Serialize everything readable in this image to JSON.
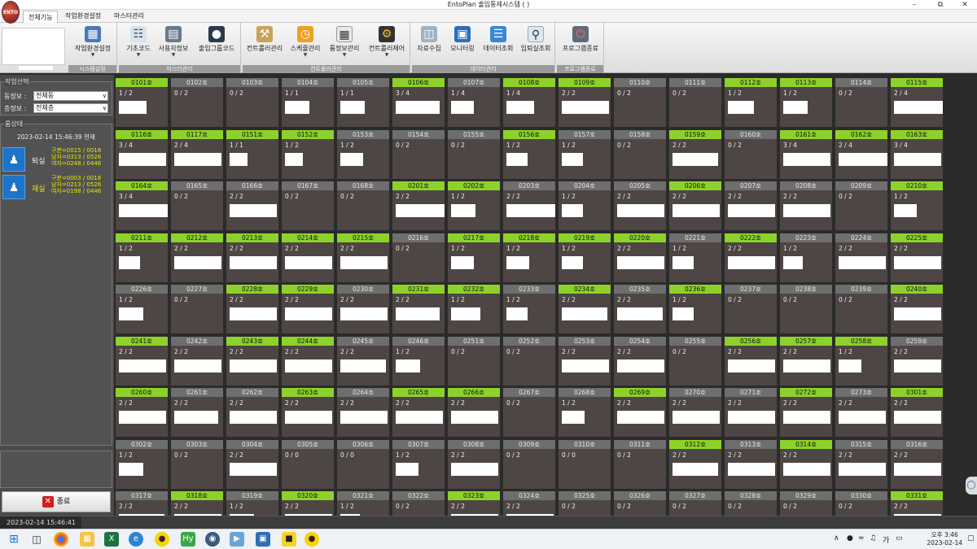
{
  "titlebar": {
    "title": "EntoPlan 출입통제시스템 (                              )",
    "logo": "ENTO",
    "minimize_icon": "minimize-icon",
    "maximize_icon": "maximize-icon",
    "close_icon": "close-icon"
  },
  "menu": {
    "tabs": [
      {
        "label": "전체기능"
      },
      {
        "label": "작업환경설정"
      },
      {
        "label": "마스터관리"
      }
    ]
  },
  "ribbon": {
    "groups": [
      {
        "label": "시스템설정",
        "buttons": [
          {
            "label": "작업환경설정",
            "icon": "work-settings-icon"
          }
        ]
      },
      {
        "label": "마스터관리",
        "buttons": [
          {
            "label": "기초코드",
            "icon": "base-code-icon"
          },
          {
            "label": "사용자정보",
            "icon": "user-info-icon"
          },
          {
            "label": "출입그룹코드",
            "icon": "access-group-icon"
          }
        ]
      },
      {
        "label": "컨트롤러관리",
        "buttons": [
          {
            "label": "컨트롤러관리",
            "icon": "controller-icon"
          },
          {
            "label": "스케쥴관리",
            "icon": "schedule-icon"
          },
          {
            "label": "룸정보관리",
            "icon": "room-info-icon"
          },
          {
            "label": "컨트롤러제어",
            "icon": "controller-control-icon"
          }
        ]
      },
      {
        "label": "데이터관리",
        "buttons": [
          {
            "label": "자료수집",
            "icon": "data-collect-icon"
          },
          {
            "label": "모니터링",
            "icon": "monitor-icon"
          },
          {
            "label": "데이터조회",
            "icon": "data-query-icon"
          },
          {
            "label": "입퇴실조회",
            "icon": "checkin-query-icon"
          }
        ]
      },
      {
        "label": "프로그램종료",
        "buttons": [
          {
            "label": "프로그램종료",
            "icon": "program-exit-icon"
          }
        ]
      }
    ]
  },
  "sidebar": {
    "task_title": "작업선택",
    "building_label": "동정보 :",
    "building_value": "전체동",
    "floor_label": "층정보 :",
    "floor_value": "전체층",
    "status_title": "룸상태",
    "timestamp": "2023-02-14 15:46:39 현재",
    "checkout_label": "퇴실",
    "checkout_stats": "구분=0015 / 0018\n남자=0313 / 0526\n여자=0248 / 0446",
    "occupied_label": "재실",
    "occupied_stats": "구분=0003 / 0018\n남자=0213 / 0526\n여자=0198 / 0446",
    "exit_label": "종료"
  },
  "rooms": [
    {
      "no": "0101호",
      "c": "1/2",
      "on": true,
      "w": 34
    },
    {
      "no": "0102호",
      "c": "0/2",
      "on": false,
      "w": 0
    },
    {
      "no": "0103호",
      "c": "0/2",
      "on": false,
      "w": 0
    },
    {
      "no": "0104호",
      "c": "1/1",
      "on": false,
      "w": 30
    },
    {
      "no": "0105호",
      "c": "1/1",
      "on": false,
      "w": 30
    },
    {
      "no": "0106호",
      "c": "3/4",
      "on": true,
      "w": 54
    },
    {
      "no": "0107호",
      "c": "1/4",
      "on": false,
      "w": 28
    },
    {
      "no": "0108호",
      "c": "1/4",
      "on": true,
      "w": 34
    },
    {
      "no": "0109호",
      "c": "2/2",
      "on": true,
      "w": 58
    },
    {
      "no": "0110호",
      "c": "0/2",
      "on": false,
      "w": 0
    },
    {
      "no": "0111호",
      "c": "0/2",
      "on": false,
      "w": 0
    },
    {
      "no": "0112호",
      "c": "1/2",
      "on": true,
      "w": 32
    },
    {
      "no": "0113호",
      "c": "1/2",
      "on": true,
      "w": 30
    },
    {
      "no": "0114호",
      "c": "0/2",
      "on": false,
      "w": 0
    },
    {
      "no": "0115호",
      "c": "2/4",
      "on": true,
      "w": 60
    },
    {
      "no": "0116호",
      "c": "3/4",
      "on": true,
      "w": 58
    },
    {
      "no": "0117호",
      "c": "2/4",
      "on": true,
      "w": 58
    },
    {
      "no": "0151호",
      "c": "1/1",
      "on": true,
      "w": 22
    },
    {
      "no": "0152호",
      "c": "1/2",
      "on": true,
      "w": 22
    },
    {
      "no": "0153호",
      "c": "1/2",
      "on": false,
      "w": 28
    },
    {
      "no": "0154호",
      "c": "0/2",
      "on": false,
      "w": 0
    },
    {
      "no": "0155호",
      "c": "0/2",
      "on": false,
      "w": 0
    },
    {
      "no": "0156호",
      "c": "1/2",
      "on": true,
      "w": 26
    },
    {
      "no": "0157호",
      "c": "1/2",
      "on": false,
      "w": 26
    },
    {
      "no": "0158호",
      "c": "0/2",
      "on": false,
      "w": 0
    },
    {
      "no": "0159호",
      "c": "2/2",
      "on": true,
      "w": 56
    },
    {
      "no": "0160호",
      "c": "0/2",
      "on": false,
      "w": 0
    },
    {
      "no": "0161호",
      "c": "3/4",
      "on": true,
      "w": 58
    },
    {
      "no": "0162호",
      "c": "2/4",
      "on": true,
      "w": 60
    },
    {
      "no": "0163호",
      "c": "3/4",
      "on": true,
      "w": 58
    },
    {
      "no": "0164호",
      "c": "3/4",
      "on": true,
      "w": 60
    },
    {
      "no": "0165호",
      "c": "0/2",
      "on": false,
      "w": 0
    },
    {
      "no": "0166호",
      "c": "2/2",
      "on": false,
      "w": 58
    },
    {
      "no": "0167호",
      "c": "0/2",
      "on": false,
      "w": 0
    },
    {
      "no": "0168호",
      "c": "0/2",
      "on": false,
      "w": 0
    },
    {
      "no": "0201호",
      "c": "2/2",
      "on": true,
      "w": 60
    },
    {
      "no": "0202호",
      "c": "1/2",
      "on": true,
      "w": 30
    },
    {
      "no": "0203호",
      "c": "2/2",
      "on": false,
      "w": 60
    },
    {
      "no": "0204호",
      "c": "1/2",
      "on": false,
      "w": 26
    },
    {
      "no": "0205호",
      "c": "2/2",
      "on": false,
      "w": 58
    },
    {
      "no": "0206호",
      "c": "2/2",
      "on": true,
      "w": 58
    },
    {
      "no": "0207호",
      "c": "2/2",
      "on": false,
      "w": 58
    },
    {
      "no": "0208호",
      "c": "2/2",
      "on": false,
      "w": 58
    },
    {
      "no": "0209호",
      "c": "0/2",
      "on": false,
      "w": 0
    },
    {
      "no": "0210호",
      "c": "1/2",
      "on": true,
      "w": 28
    },
    {
      "no": "0211호",
      "c": "1/2",
      "on": true,
      "w": 26
    },
    {
      "no": "0212호",
      "c": "2/2",
      "on": true,
      "w": 58
    },
    {
      "no": "0213호",
      "c": "2/2",
      "on": true,
      "w": 58
    },
    {
      "no": "0214호",
      "c": "2/2",
      "on": true,
      "w": 58
    },
    {
      "no": "0215호",
      "c": "2/2",
      "on": true,
      "w": 58
    },
    {
      "no": "0216호",
      "c": "0/2",
      "on": false,
      "w": 0
    },
    {
      "no": "0217호",
      "c": "1/2",
      "on": true,
      "w": 28
    },
    {
      "no": "0218호",
      "c": "1/2",
      "on": true,
      "w": 28
    },
    {
      "no": "0219호",
      "c": "1/2",
      "on": true,
      "w": 26
    },
    {
      "no": "0220호",
      "c": "2/2",
      "on": true,
      "w": 58
    },
    {
      "no": "0221호",
      "c": "1/2",
      "on": false,
      "w": 26
    },
    {
      "no": "0222호",
      "c": "2/2",
      "on": true,
      "w": 58
    },
    {
      "no": "0223호",
      "c": "1/2",
      "on": false,
      "w": 24
    },
    {
      "no": "0224호",
      "c": "2/2",
      "on": false,
      "w": 58
    },
    {
      "no": "0225호",
      "c": "2/2",
      "on": true,
      "w": 58
    },
    {
      "no": "0226호",
      "c": "1/2",
      "on": false,
      "w": 30
    },
    {
      "no": "0227호",
      "c": "0/2",
      "on": false,
      "w": 0
    },
    {
      "no": "0228호",
      "c": "2/2",
      "on": true,
      "w": 58
    },
    {
      "no": "0229호",
      "c": "2/2",
      "on": true,
      "w": 58
    },
    {
      "no": "0230호",
      "c": "2/2",
      "on": false,
      "w": 58
    },
    {
      "no": "0231호",
      "c": "2/2",
      "on": true,
      "w": 54
    },
    {
      "no": "0232호",
      "c": "1/2",
      "on": true,
      "w": 36
    },
    {
      "no": "0233호",
      "c": "1/2",
      "on": false,
      "w": 26
    },
    {
      "no": "0234호",
      "c": "2/2",
      "on": true,
      "w": 56
    },
    {
      "no": "0235호",
      "c": "2/2",
      "on": false,
      "w": 56
    },
    {
      "no": "0236호",
      "c": "1/2",
      "on": true,
      "w": 26
    },
    {
      "no": "0237호",
      "c": "0/2",
      "on": false,
      "w": 0
    },
    {
      "no": "0238호",
      "c": "0/2",
      "on": false,
      "w": 0
    },
    {
      "no": "0239호",
      "c": "0/2",
      "on": false,
      "w": 0
    },
    {
      "no": "0240호",
      "c": "2/2",
      "on": true,
      "w": 58
    },
    {
      "no": "0241호",
      "c": "2/2",
      "on": true,
      "w": 58
    },
    {
      "no": "0242호",
      "c": "2/2",
      "on": false,
      "w": 58
    },
    {
      "no": "0243호",
      "c": "2/2",
      "on": true,
      "w": 58
    },
    {
      "no": "0244호",
      "c": "2/2",
      "on": true,
      "w": 58
    },
    {
      "no": "0245호",
      "c": "2/2",
      "on": false,
      "w": 56
    },
    {
      "no": "0246호",
      "c": "1/2",
      "on": false,
      "w": 30
    },
    {
      "no": "0251호",
      "c": "0/2",
      "on": false,
      "w": 0
    },
    {
      "no": "0252호",
      "c": "0/2",
      "on": false,
      "w": 0
    },
    {
      "no": "0253호",
      "c": "2/2",
      "on": false,
      "w": 58
    },
    {
      "no": "0254호",
      "c": "2/2",
      "on": false,
      "w": 58
    },
    {
      "no": "0255호",
      "c": "0/2",
      "on": false,
      "w": 0
    },
    {
      "no": "0256호",
      "c": "2/2",
      "on": true,
      "w": 58
    },
    {
      "no": "0257호",
      "c": "2/2",
      "on": true,
      "w": 58
    },
    {
      "no": "0258호",
      "c": "1/2",
      "on": true,
      "w": 28
    },
    {
      "no": "0259호",
      "c": "2/2",
      "on": false,
      "w": 58
    },
    {
      "no": "0260호",
      "c": "2/2",
      "on": true,
      "w": 58
    },
    {
      "no": "0261호",
      "c": "2/2",
      "on": false,
      "w": 54
    },
    {
      "no": "0262호",
      "c": "2/2",
      "on": false,
      "w": 58
    },
    {
      "no": "0263호",
      "c": "2/2",
      "on": true,
      "w": 58
    },
    {
      "no": "0264호",
      "c": "2/2",
      "on": false,
      "w": 58
    },
    {
      "no": "0265호",
      "c": "2/2",
      "on": true,
      "w": 58
    },
    {
      "no": "0266호",
      "c": "2/2",
      "on": true,
      "w": 58
    },
    {
      "no": "0267호",
      "c": "0/2",
      "on": false,
      "w": 0
    },
    {
      "no": "0268호",
      "c": "1/2",
      "on": false,
      "w": 28
    },
    {
      "no": "0269호",
      "c": "2/2",
      "on": true,
      "w": 58
    },
    {
      "no": "0270호",
      "c": "2/2",
      "on": false,
      "w": 58
    },
    {
      "no": "0271호",
      "c": "2/2",
      "on": false,
      "w": 58
    },
    {
      "no": "0272호",
      "c": "2/2",
      "on": true,
      "w": 58
    },
    {
      "no": "0273호",
      "c": "2/2",
      "on": false,
      "w": 58
    },
    {
      "no": "0301호",
      "c": "2/2",
      "on": true,
      "w": 58
    },
    {
      "no": "0302호",
      "c": "1/2",
      "on": false,
      "w": 30
    },
    {
      "no": "0303호",
      "c": "0/2",
      "on": false,
      "w": 0
    },
    {
      "no": "0304호",
      "c": "2/2",
      "on": false,
      "w": 58
    },
    {
      "no": "0305호",
      "c": "0/0",
      "on": false,
      "w": 0
    },
    {
      "no": "0306호",
      "c": "0/0",
      "on": false,
      "w": 0
    },
    {
      "no": "0307호",
      "c": "1/2",
      "on": false,
      "w": 28
    },
    {
      "no": "0308호",
      "c": "2/2",
      "on": false,
      "w": 58
    },
    {
      "no": "0309호",
      "c": "0/2",
      "on": false,
      "w": 0
    },
    {
      "no": "0310호",
      "c": "0/0",
      "on": false,
      "w": 0
    },
    {
      "no": "0311호",
      "c": "0/2",
      "on": false,
      "w": 0
    },
    {
      "no": "0312호",
      "c": "2/2",
      "on": true,
      "w": 56
    },
    {
      "no": "0313호",
      "c": "2/2",
      "on": false,
      "w": 58
    },
    {
      "no": "0314호",
      "c": "2/2",
      "on": true,
      "w": 58
    },
    {
      "no": "0315호",
      "c": "2/2",
      "on": false,
      "w": 58
    },
    {
      "no": "0316호",
      "c": "2/2",
      "on": false,
      "w": 58
    },
    {
      "no": "0317호",
      "c": "2/2",
      "on": false,
      "w": 56
    },
    {
      "no": "0318호",
      "c": "2/2",
      "on": true,
      "w": 58
    },
    {
      "no": "0319호",
      "c": "1/2",
      "on": false,
      "w": 30
    },
    {
      "no": "0320호",
      "c": "2/2",
      "on": true,
      "w": 58
    },
    {
      "no": "0321호",
      "c": "1/2",
      "on": false,
      "w": 24
    },
    {
      "no": "0322호",
      "c": "0/2",
      "on": false,
      "w": 0
    },
    {
      "no": "0323호",
      "c": "2/2",
      "on": true,
      "w": 58
    },
    {
      "no": "0324호",
      "c": "2/2",
      "on": false,
      "w": 58
    },
    {
      "no": "0325호",
      "c": "0/2",
      "on": false,
      "w": 0
    },
    {
      "no": "0326호",
      "c": "0/2",
      "on": false,
      "w": 0
    },
    {
      "no": "0327호",
      "c": "0/2",
      "on": false,
      "w": 0
    },
    {
      "no": "0328호",
      "c": "0/2",
      "on": false,
      "w": 0
    },
    {
      "no": "0329호",
      "c": "0/2",
      "on": false,
      "w": 0
    },
    {
      "no": "0330호",
      "c": "0/2",
      "on": false,
      "w": 0
    },
    {
      "no": "0331호",
      "c": "2/2",
      "on": true,
      "w": 58
    }
  ],
  "statusbar": {
    "datetime": "2023-02-14 15:46:41"
  },
  "taskbar": {
    "icons": [
      "windows-start-icon",
      "task-view-icon",
      "chrome-icon",
      "file-explorer-icon",
      "excel-icon",
      "edge-icon",
      "kakaotalk-icon",
      "hy-app-icon",
      "network-app-icon",
      "remote-app-icon",
      "terminal-app-icon",
      "sticky-notes-icon",
      "kakaotalk-icon"
    ],
    "tray_lang": "가",
    "clock_time": "오후 3:46",
    "clock_date": "2023-02-14"
  },
  "colors": {
    "occupied_header": "#8dd22a",
    "vacant_header": "#6e6e6e",
    "room_body": "#4e4644",
    "stats_text": "#e6e600"
  }
}
